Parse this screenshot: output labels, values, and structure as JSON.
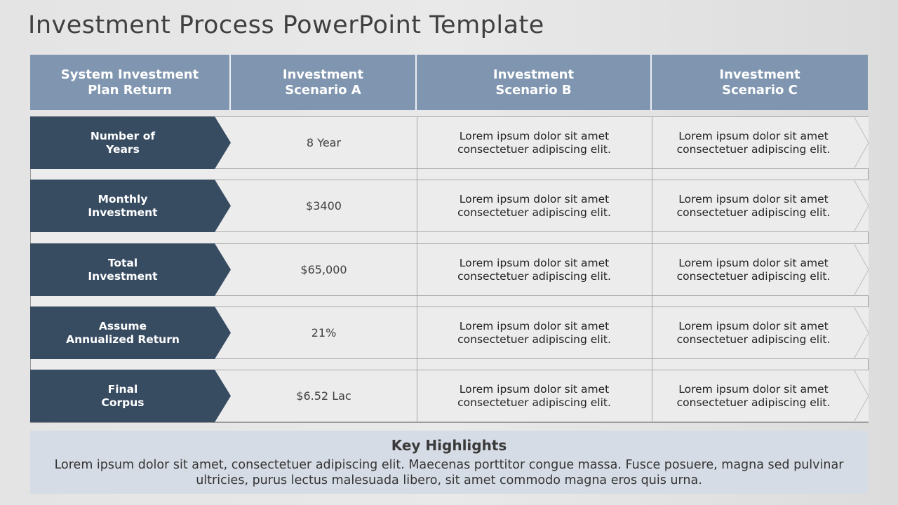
{
  "title": "Investment Process PowerPoint Template",
  "colors": {
    "header_bg": "#8096b0",
    "label_bg": "#374b61",
    "cell_bg": "#ececec",
    "highlights_bg": "#d6dce5"
  },
  "table": {
    "headers": [
      "System Investment\nPlan Return",
      "Investment\nScenario A",
      "Investment\nScenario B",
      "Investment\nScenario C"
    ],
    "rows": [
      {
        "label": "Number of\nYears",
        "scenario_a": "8 Year",
        "scenario_b": "Lorem ipsum dolor sit amet\nconsectetuer adipiscing elit.",
        "scenario_c": "Lorem ipsum dolor sit amet\nconsectetuer adipiscing elit."
      },
      {
        "label": "Monthly\nInvestment",
        "scenario_a": "$3400",
        "scenario_b": "Lorem ipsum dolor sit amet\nconsectetuer adipiscing elit.",
        "scenario_c": "Lorem ipsum dolor sit amet\nconsectetuer adipiscing elit."
      },
      {
        "label": "Total\nInvestment",
        "scenario_a": "$65,000",
        "scenario_b": "Lorem ipsum dolor sit amet\nconsectetuer adipiscing elit.",
        "scenario_c": "Lorem ipsum dolor sit amet\nconsectetuer adipiscing elit."
      },
      {
        "label": "Assume\nAnnualized Return",
        "scenario_a": "21%",
        "scenario_b": "Lorem ipsum dolor sit amet\nconsectetuer adipiscing elit.",
        "scenario_c": "Lorem ipsum dolor sit amet\nconsectetuer adipiscing elit."
      },
      {
        "label": "Final\nCorpus",
        "scenario_a": "$6.52 Lac",
        "scenario_b": "Lorem ipsum dolor sit amet\nconsectetuer adipiscing elit.",
        "scenario_c": "Lorem ipsum dolor sit amet\nconsectetuer adipiscing elit."
      }
    ]
  },
  "highlights": {
    "title": "Key Highlights",
    "text": "Lorem ipsum dolor sit amet, consectetuer adipiscing elit. Maecenas porttitor congue massa. Fusce posuere, magna sed pulvinar ultricies, purus lectus malesuada libero, sit amet commodo magna eros quis urna."
  }
}
